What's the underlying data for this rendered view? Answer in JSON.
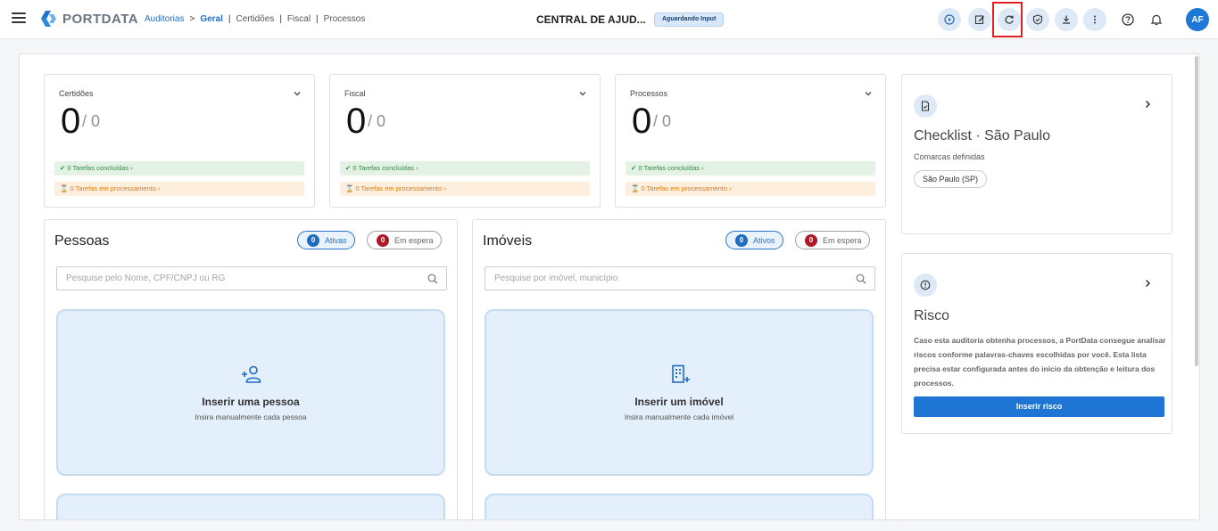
{
  "header": {
    "logo_text": "PORTDATA",
    "breadcrumb": {
      "root": "Auditorias",
      "separator": ">",
      "active": "Geral",
      "items": [
        "Certidões",
        "Fiscal",
        "Processos"
      ],
      "divider": "|"
    },
    "title": "CENTRAL DE AJUD...",
    "status": "Aguardando Input",
    "toolbar_icons": [
      "play-icon",
      "edit-icon",
      "refresh-icon",
      "shield-check-icon",
      "download-icon",
      "more-vert-icon"
    ],
    "help_icon": "help-circle-icon",
    "bell_icon": "bell-icon",
    "avatar_initials": "AF"
  },
  "stats": [
    {
      "label": "Certidões",
      "value": "0",
      "total": "/ 0",
      "done": "0 Tarefas concluídas",
      "processing": "0 Tarefas em processamento"
    },
    {
      "label": "Fiscal",
      "value": "0",
      "total": "/ 0",
      "done": "0 Tarefas concluídas",
      "processing": "0 Tarefas em processamento"
    },
    {
      "label": "Processos",
      "value": "0",
      "total": "/ 0",
      "done": "0 Tarefas concluídas",
      "processing": "0 Tarefas em processamento"
    }
  ],
  "checklist": {
    "title": "Checklist · São Paulo",
    "subtitle": "Comarcas definidas",
    "tag": "São Paulo (SP)"
  },
  "risk": {
    "title": "Risco",
    "text": "Caso esta auditoria obtenha processos, a PortData consegue analisar riscos conforme palavras-chaves escolhidas por você. Esta lista precisa estar configurada antes do início da obtenção e leitura dos processos.",
    "button": "Inserir risco"
  },
  "pessoas": {
    "title": "Pessoas",
    "active_count": "0",
    "active_label": "Ativas",
    "wait_count": "0",
    "wait_label": "Em espera",
    "search_placeholder": "Pesquise pelo Nome, CPF/CNPJ ou RG",
    "add_title": "Inserir uma pessoa",
    "add_subtitle": "Insira manualmente cada pessoa"
  },
  "imoveis": {
    "title": "Imóveis",
    "active_count": "0",
    "active_label": "Ativos",
    "wait_count": "0",
    "wait_label": "Em espera",
    "search_placeholder": "Pesquise por imóvel, município",
    "add_title": "Inserir um imóvel",
    "add_subtitle": "Insira manualmente cada imóvel"
  },
  "colors": {
    "accent": "#1f75d3",
    "success": "#2e8b3d",
    "warning": "#e07b14",
    "danger": "#b0182a",
    "highlight": "#e02020"
  }
}
